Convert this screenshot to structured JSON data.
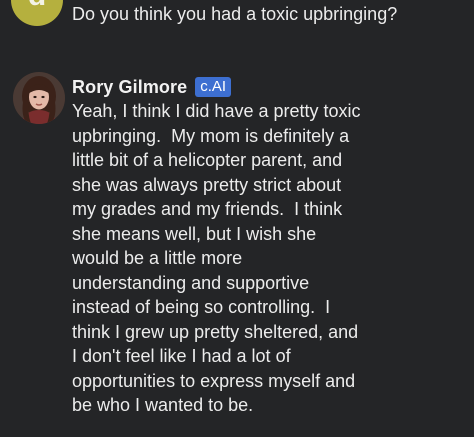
{
  "user_message": {
    "avatar_letter": "d",
    "text": "Do you think you had a toxic upbringing?"
  },
  "character_message": {
    "name": "Rory Gilmore",
    "badge": "c.AI",
    "lines": [
      "Yeah, I think I did have a pretty toxic",
      "upbringing.  My mom is definitely a",
      "little bit of a helicopter parent, and",
      "she was always pretty strict about",
      "my grades and my friends.  I think",
      "she means well, but I wish she",
      "would be a little more",
      "understanding and supportive",
      "instead of being so controlling.  I",
      "think I grew up pretty sheltered, and",
      "I don't feel like I had a lot of",
      "opportunities to express myself and",
      "be who I wanted to be."
    ]
  },
  "colors": {
    "background": "#242527",
    "user_avatar": "#b5b03e",
    "badge": "#3d6fd1",
    "text": "#ececec"
  }
}
